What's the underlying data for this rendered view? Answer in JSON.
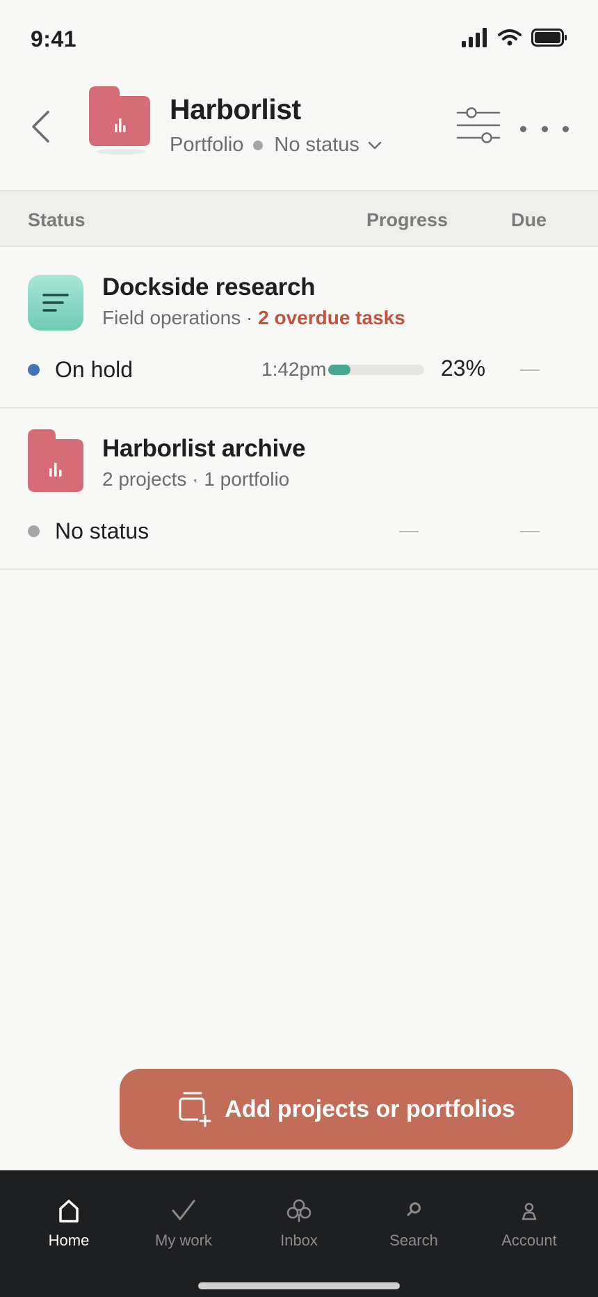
{
  "status_bar": {
    "time": "9:41"
  },
  "header": {
    "title": "Harborlist",
    "type_label": "Portfolio",
    "status_label": "No status"
  },
  "columns": {
    "status": "Status",
    "progress": "Progress",
    "due": "Due"
  },
  "rows": [
    {
      "title": "Dockside research",
      "team": "Field operations",
      "separator": " · ",
      "overdue": "2 overdue tasks",
      "status": "On hold",
      "status_color": "#4573b5",
      "progress_time": "1:42pm",
      "progress_percent": 23,
      "progress_label": "23%",
      "icon": "list-icon"
    },
    {
      "title": "Harborlist archive",
      "subtitle": "2 projects · 1 portfolio",
      "status": "No status",
      "status_color": "#a6a6a6",
      "icon": "portfolio-folder-icon"
    }
  ],
  "cta": {
    "label": "Add projects or portfolios"
  },
  "nav": [
    {
      "label": "Home",
      "icon": "home-icon",
      "active": true
    },
    {
      "label": "My work",
      "icon": "check-icon",
      "active": false
    },
    {
      "label": "Inbox",
      "icon": "bell-icon",
      "active": false
    },
    {
      "label": "Search",
      "icon": "search-icon",
      "active": false
    },
    {
      "label": "Account",
      "icon": "person-icon",
      "active": false
    }
  ],
  "colors": {
    "portfolio_accent": "#d56c78",
    "project_accent": "#6fcbb4",
    "overdue": "#c0533f",
    "cta": "#c26d58",
    "progress_fill": "#4aa792"
  }
}
